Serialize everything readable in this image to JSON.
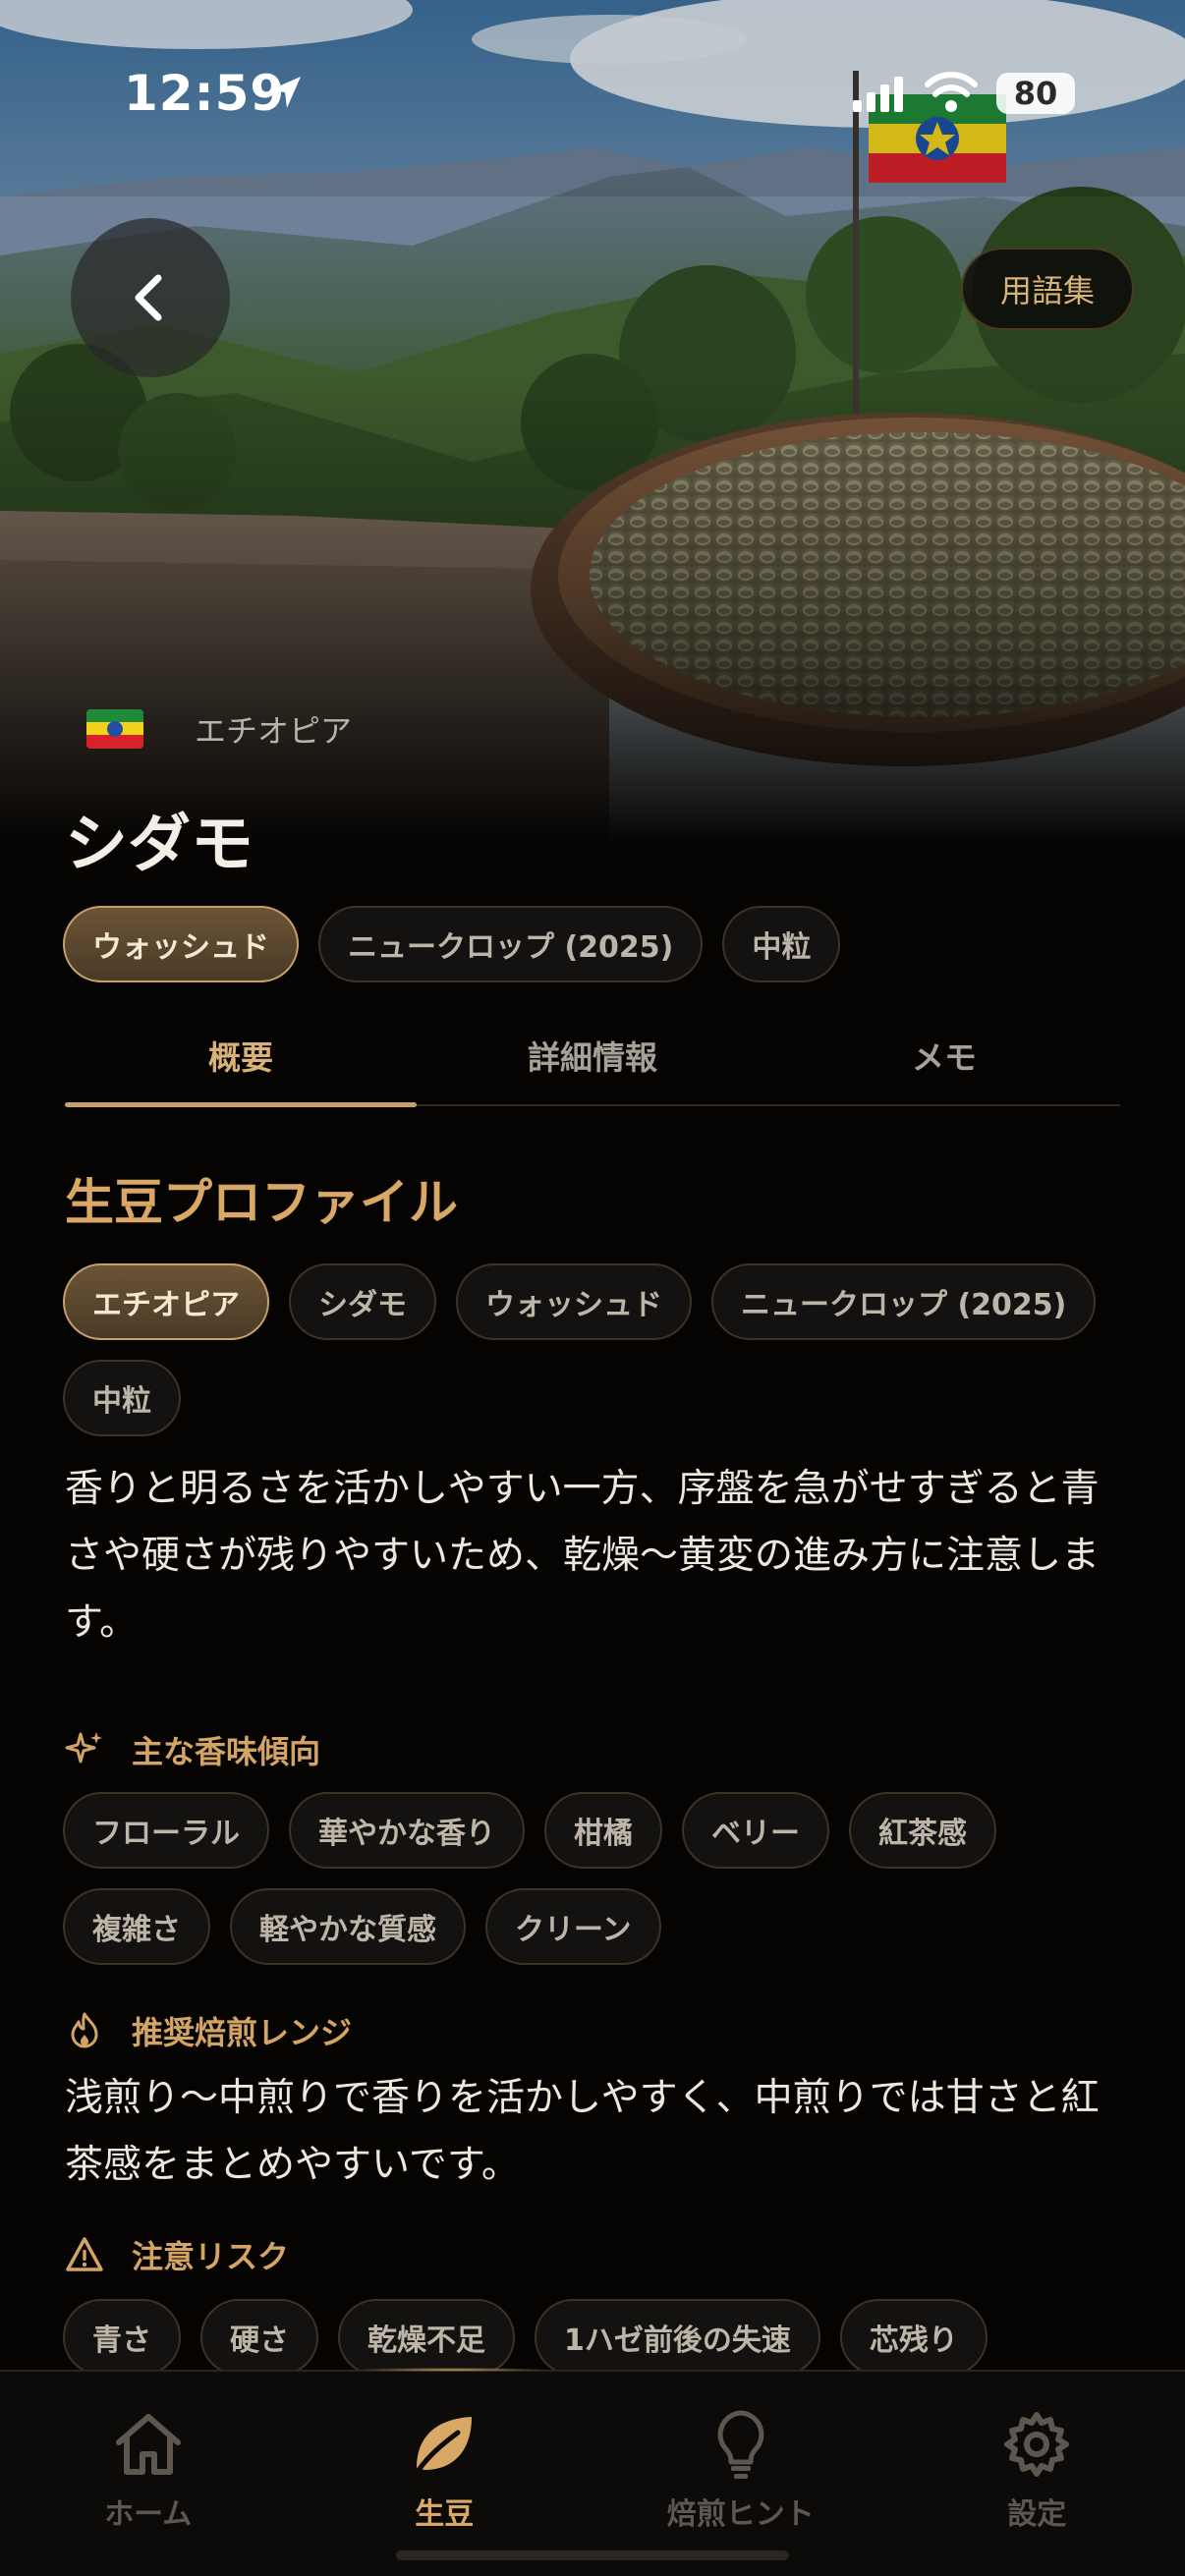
{
  "status_bar": {
    "time": "12:59",
    "battery": "80"
  },
  "header": {
    "glossary_label": "用語集"
  },
  "bean": {
    "origin": "エチオピア",
    "name": "シダモ",
    "tags": [
      {
        "label": "ウォッシュド",
        "active": true
      },
      {
        "label": "ニュークロップ (2025)",
        "active": false
      },
      {
        "label": "中粒",
        "active": false
      }
    ]
  },
  "tabs": [
    {
      "label": "概要",
      "active": true
    },
    {
      "label": "詳細情報",
      "active": false
    },
    {
      "label": "メモ",
      "active": false
    }
  ],
  "profile": {
    "title": "生豆プロファイル",
    "tags": [
      {
        "label": "エチオピア",
        "active": true
      },
      {
        "label": "シダモ",
        "active": false
      },
      {
        "label": "ウォッシュド",
        "active": false
      },
      {
        "label": "ニュークロップ (2025)",
        "active": false
      },
      {
        "label": "中粒",
        "active": false
      }
    ],
    "description": "香りと明るさを活かしやすい一方、序盤を急がせすぎると青さや硬さが残りやすいため、乾燥〜黄変の進み方に注意します。"
  },
  "flavor": {
    "heading": "主な香味傾向",
    "tags": [
      "フローラル",
      "華やかな香り",
      "柑橘",
      "ベリー",
      "紅茶感",
      "複雑さ",
      "軽やかな質感",
      "クリーン"
    ]
  },
  "roast": {
    "heading": "推奨焙煎レンジ",
    "text": "浅煎り〜中煎りで香りを活かしやすく、中煎りでは甘さと紅茶感をまとめやすいです。"
  },
  "risk": {
    "heading": "注意リスク",
    "tags": [
      "青さ",
      "硬さ",
      "乾燥不足",
      "1ハゼ前後の失速",
      "芯残り"
    ]
  },
  "nav": [
    {
      "label": "ホーム",
      "icon": "home-icon",
      "active": false
    },
    {
      "label": "生豆",
      "icon": "leaf-icon",
      "active": true
    },
    {
      "label": "焙煎ヒント",
      "icon": "lightbulb-icon",
      "active": false
    },
    {
      "label": "設定",
      "icon": "gear-icon",
      "active": false
    }
  ],
  "colors": {
    "accent": "#d9a866",
    "background": "#050403"
  }
}
